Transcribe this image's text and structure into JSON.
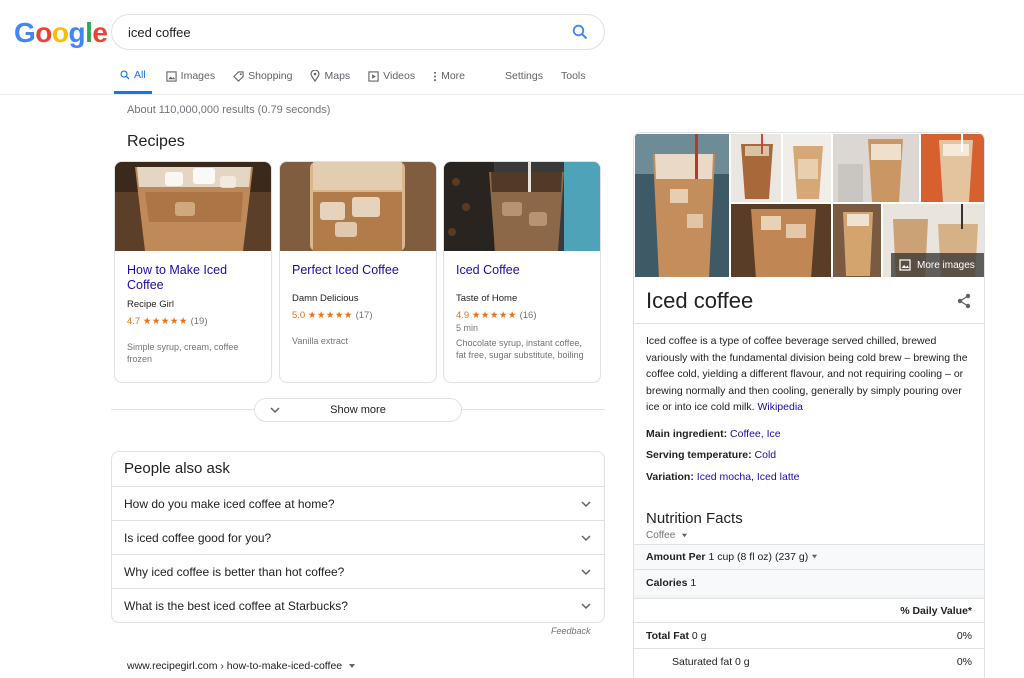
{
  "logo": [
    "G",
    "o",
    "o",
    "g",
    "l",
    "e"
  ],
  "search": {
    "value": "iced coffee"
  },
  "tabs": [
    {
      "label": "All",
      "icon": "search-icon",
      "active": true
    },
    {
      "label": "Images",
      "icon": "image-icon"
    },
    {
      "label": "Shopping",
      "icon": "tag-icon"
    },
    {
      "label": "Maps",
      "icon": "map-pin-icon"
    },
    {
      "label": "Videos",
      "icon": "play-icon"
    },
    {
      "label": "More",
      "icon": "more-vertical-icon"
    }
  ],
  "tools": {
    "settings": "Settings",
    "tools": "Tools"
  },
  "stats": "About 110,000,000 results (0.79 seconds)",
  "recipes": {
    "title": "Recipes",
    "cards": [
      {
        "title": "How to Make Iced Coffee",
        "source": "Recipe Girl",
        "rating": "4.7",
        "stars": "★★★★★",
        "count": "(19)",
        "time": "",
        "ingredients": "Simple syrup, cream, coffee frozen"
      },
      {
        "title": "Perfect Iced Coffee",
        "source": "Damn Delicious",
        "rating": "5.0",
        "stars": "★★★★★",
        "count": "(17)",
        "time": "",
        "ingredients": "Vanilla extract"
      },
      {
        "title": "Iced Coffee",
        "source": "Taste of Home",
        "rating": "4.9",
        "stars": "★★★★★",
        "count": "(16)",
        "time": "5 min",
        "ingredients": "Chocolate syrup, instant coffee, fat free, sugar substitute, boiling"
      }
    ],
    "show_more": "Show more"
  },
  "paa": {
    "title": "People also ask",
    "questions": [
      "How do you make iced coffee at home?",
      "Is iced coffee good for you?",
      "Why iced coffee is better than hot coffee?",
      "What is the best iced coffee at Starbucks?"
    ],
    "feedback": "Feedback"
  },
  "result": {
    "url": "www.recipegirl.com › how-to-make-iced-coffee"
  },
  "kp": {
    "more_images": "More images",
    "title": "Iced coffee",
    "description": "Iced coffee is a type of coffee beverage served chilled, brewed variously with the fundamental division being cold brew – brewing the coffee cold, yielding a different flavour, and not requiring cooling – or brewing normally and then cooling, generally by simply pouring over ice or into ice cold milk.",
    "wiki": "Wikipedia",
    "attrs": [
      {
        "label": "Main ingredient:",
        "value": "Coffee, Ice"
      },
      {
        "label": "Serving temperature:",
        "value": "Cold"
      },
      {
        "label": "Variation:",
        "value": "Iced mocha, Iced latte"
      }
    ],
    "nutrition": {
      "title": "Nutrition Facts",
      "select": "Coffee",
      "amount_label": "Amount Per",
      "amount_value": "1 cup (8 fl oz) (237 g)",
      "calories_label": "Calories",
      "calories_value": "1",
      "dv_label": "% Daily Value*",
      "rows": [
        {
          "label": "Total Fat",
          "value": "0 g",
          "pct": "0%",
          "bold": true
        },
        {
          "label": "Saturated fat",
          "value": "0 g",
          "pct": "0%",
          "bold": false
        }
      ]
    }
  }
}
